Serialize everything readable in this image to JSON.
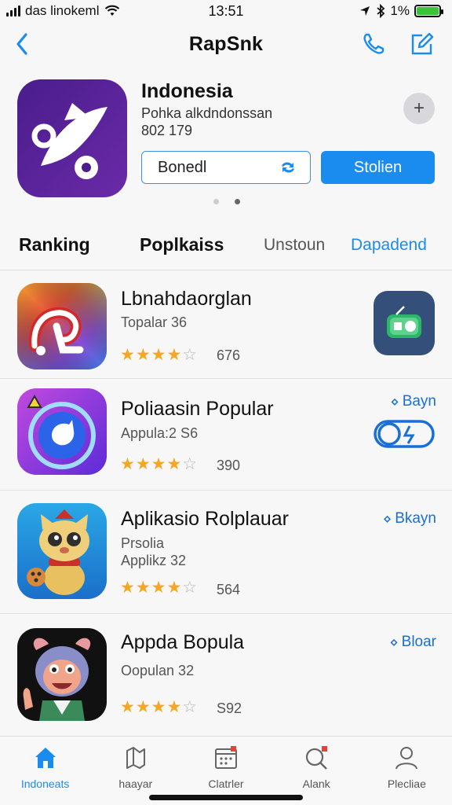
{
  "status_bar": {
    "carrier": "das linokeml",
    "time": "13:51",
    "battery_percent": "1%",
    "battery_level": 1.0
  },
  "nav": {
    "title": "RapSnk",
    "back_icon": "chevron-left-icon",
    "call_icon": "phone-icon",
    "edit_icon": "compose-icon"
  },
  "header_app": {
    "name": "Indonesia",
    "subtitle": "Pohka alkdndonssan",
    "count": "802 179",
    "more_label": "+",
    "outline_button": "Bonedl",
    "primary_button": "Stolien"
  },
  "tabs": [
    "Ranking",
    "Poplkaiss",
    "Unstoun",
    "Dapadend"
  ],
  "apps": [
    {
      "title": "Lbnahdaorglan",
      "subtitle": "Topalar 36",
      "subtitle2": "",
      "rating": 4,
      "rating_count": "676",
      "action": ""
    },
    {
      "title": "Poliaasin Popular",
      "subtitle": "Appula:2 S6",
      "subtitle2": "",
      "rating": 4,
      "rating_count": "390",
      "action": "Bayn"
    },
    {
      "title": "Aplikasio Rolplauar",
      "subtitle": "Prsolia",
      "subtitle2": "Applikz 32",
      "rating": 4,
      "rating_count": "564",
      "action": "Bkayn"
    },
    {
      "title": "Appda Bopula",
      "subtitle": "Oopulan 32",
      "subtitle2": "",
      "rating": 4,
      "rating_count": "S92",
      "action": "Bloar"
    }
  ],
  "tab_bar": [
    {
      "label": "Indoneats",
      "icon": "home-icon"
    },
    {
      "label": "haayar",
      "icon": "map-icon"
    },
    {
      "label": "Clatrler",
      "icon": "calendar-icon"
    },
    {
      "label": "Alank",
      "icon": "search-icon"
    },
    {
      "label": "Plecliae",
      "icon": "person-icon"
    }
  ],
  "colors": {
    "accent": "#1a8cf0",
    "star": "#f5a623",
    "battery": "#3cc13b"
  }
}
